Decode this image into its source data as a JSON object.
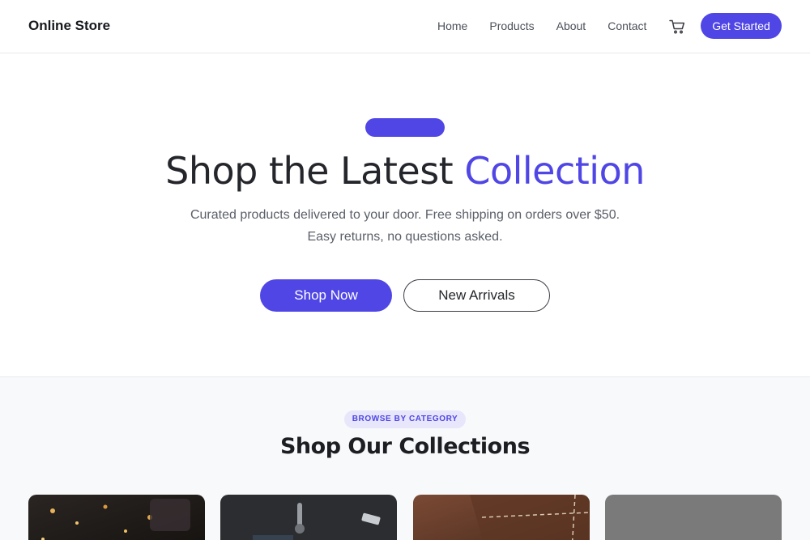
{
  "nav": {
    "brand": "Online Store",
    "links": [
      "Home",
      "Products",
      "About",
      "Contact"
    ],
    "cart_icon": "cart-icon",
    "cta_label": "Get Started"
  },
  "hero": {
    "title_part1": "Shop the Latest ",
    "title_accent": "Collection",
    "subtitle": "Curated products delivered to your door. Free shipping on orders over $50. Easy returns, no questions asked.",
    "primary_button": "Shop Now",
    "secondary_button": "New Arrivals"
  },
  "collections": {
    "eyebrow": "BROWSE BY CATEGORY",
    "title": "Shop Our Collections"
  },
  "colors": {
    "accent": "#4f46e5",
    "eyebrow_bg": "#e7e6fb",
    "section_bg": "#f8f9fb"
  }
}
